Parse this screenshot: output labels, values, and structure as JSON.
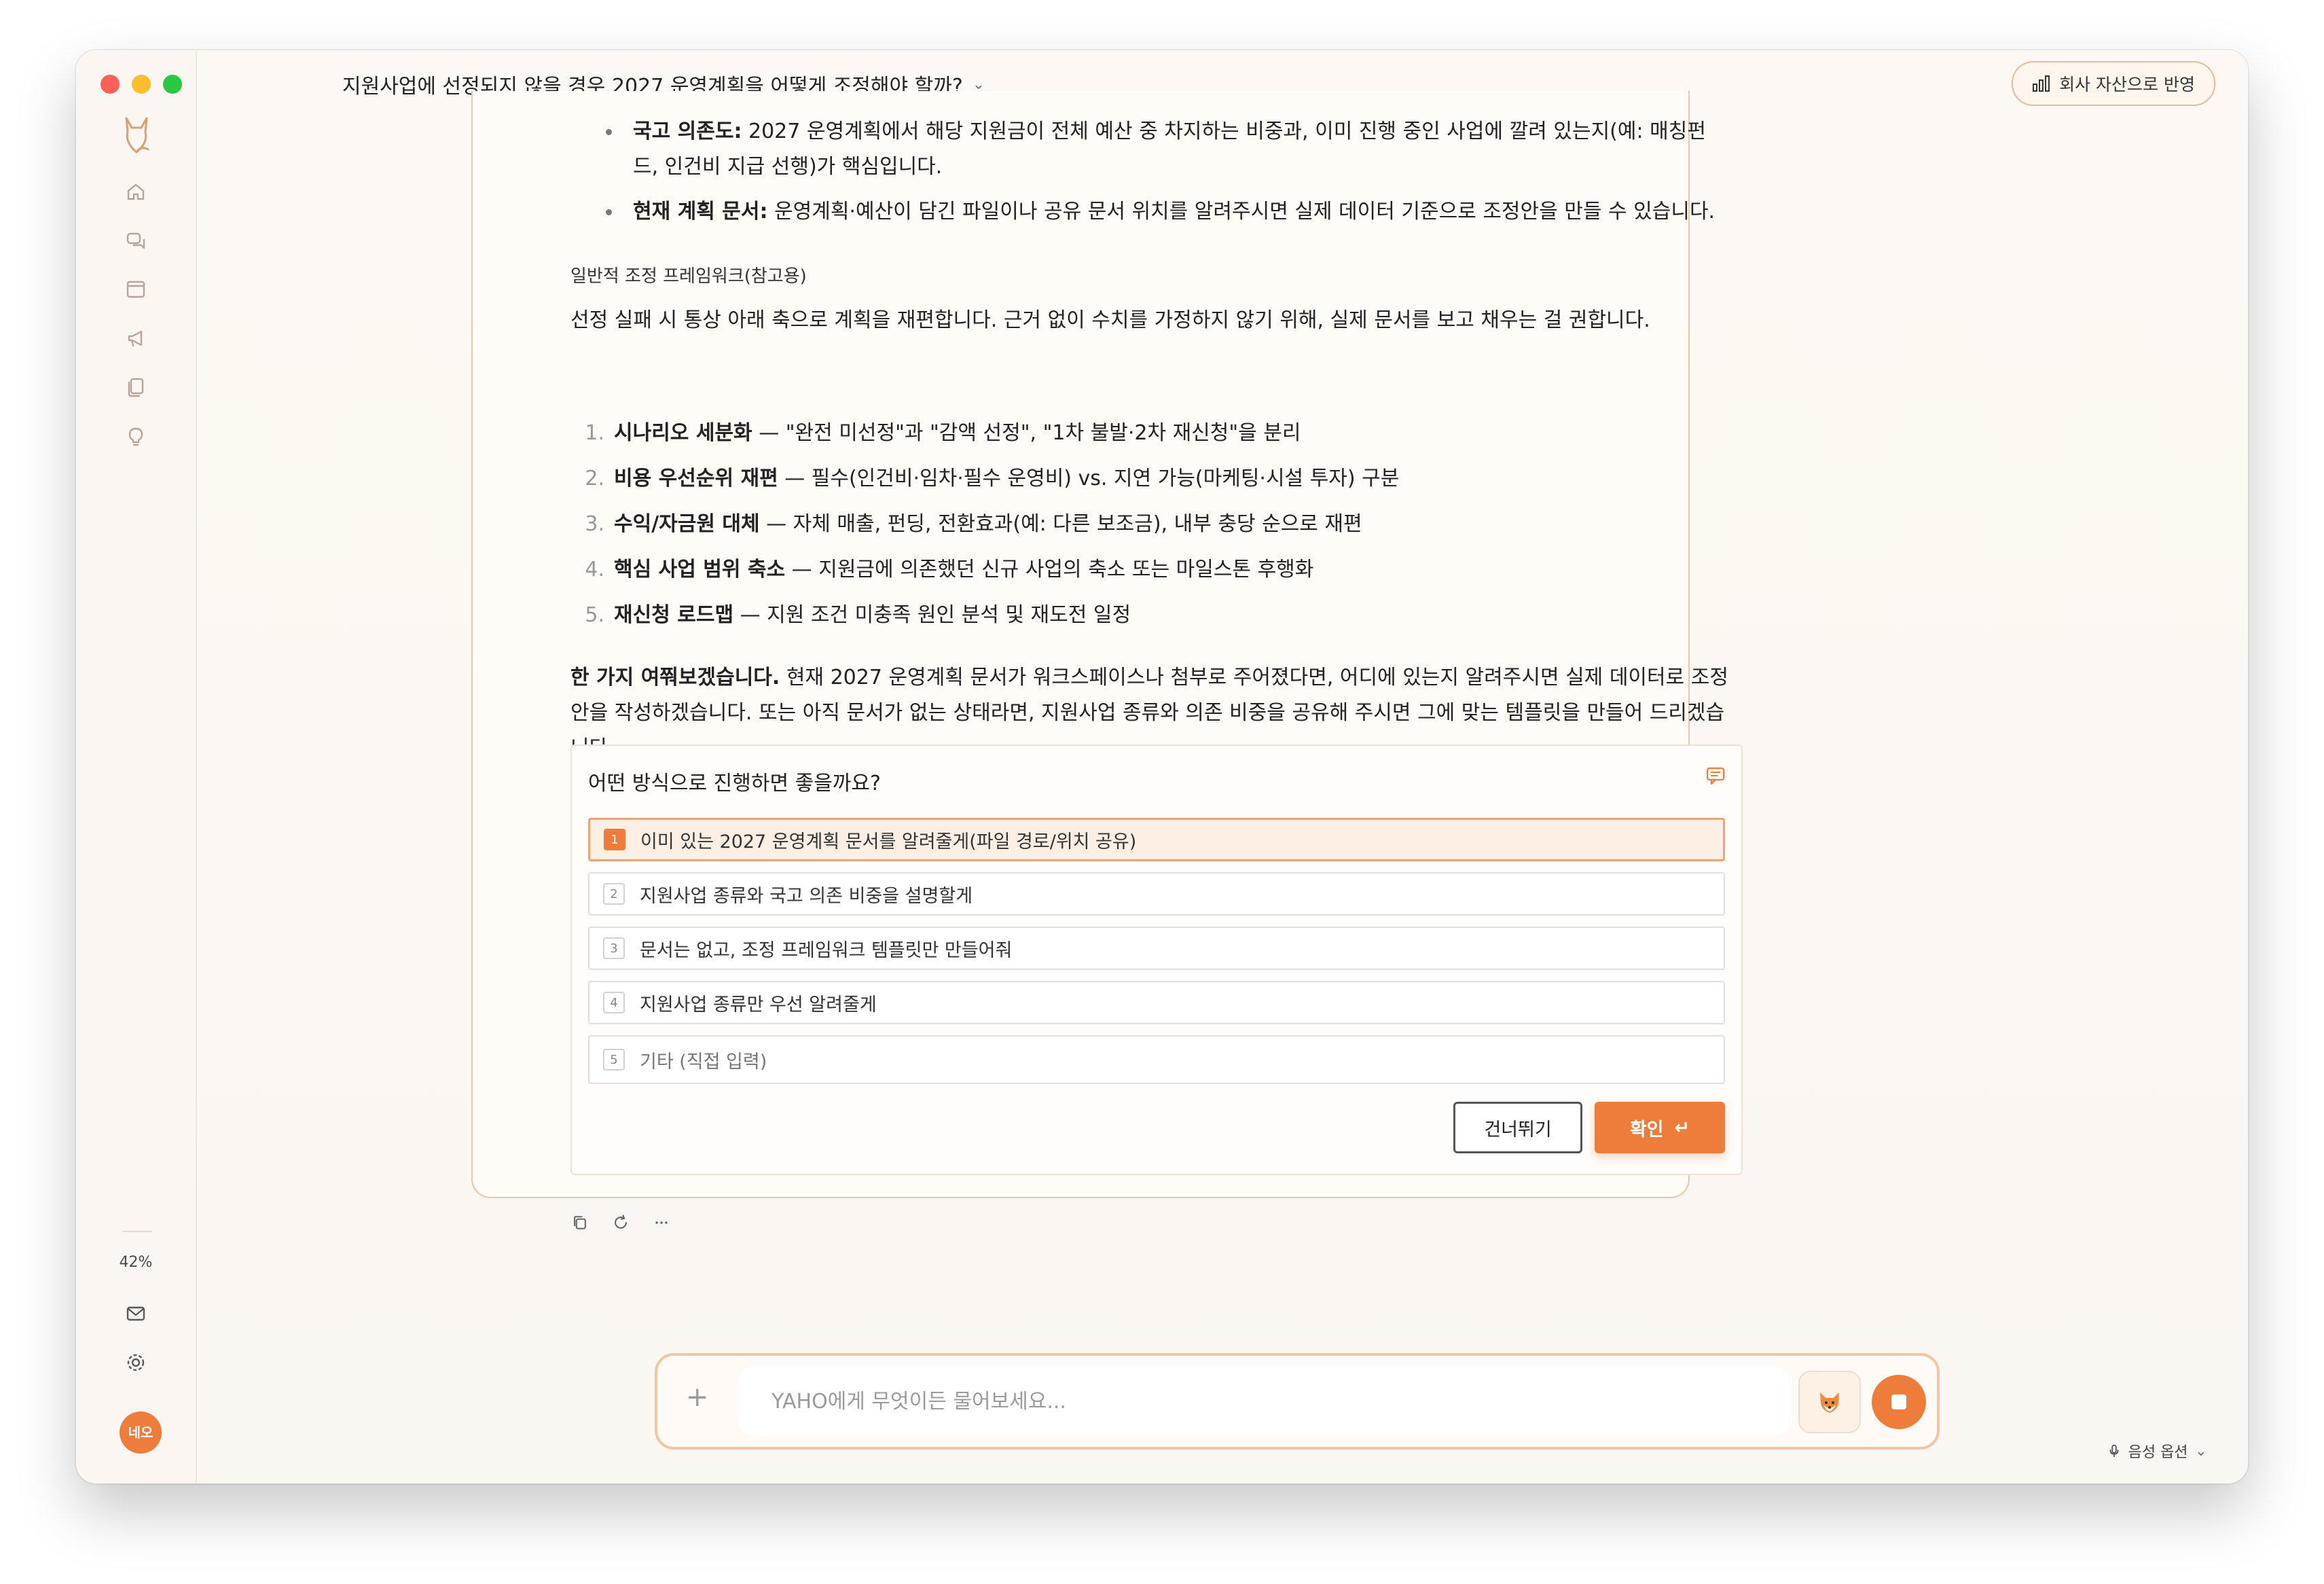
{
  "window": {
    "title": "지원사업에 선정되지 않을 경우 2027 운영계획을 어떻게 조정해야 할까?"
  },
  "header": {
    "reflect_label": "회사 자산으로 반영"
  },
  "sidebar": {
    "icons": [
      "home-icon",
      "chat-icon",
      "browser-icon",
      "megaphone-icon",
      "documents-icon",
      "lightbulb-icon"
    ],
    "zoom": "42%",
    "avatar": "네오"
  },
  "message": {
    "bullets": [
      {
        "bold": "국고 의존도:",
        "text": " 2027 운영계획에서 해당 지원금이 전체 예산 중 차지하는 비중과, 이미 진행 중인 사업에 깔려 있는지(예: 매칭펀드, 인건비 지급 선행)가 핵심입니다."
      },
      {
        "bold": "현재 계획 문서:",
        "text": " 운영계획·예산이 담긴 파일이나 공유 문서 위치를 알려주시면 실제 데이터 기준으로 조정안을 만들 수 있습니다."
      }
    ],
    "section_label": "일반적 조정 프레임워크(참고용)",
    "intro": "선정 실패 시 통상 아래 축으로 계획을 재편합니다. 근거 없이 수치를 가정하지 않기 위해, 실제 문서를 보고 채우는 걸 권합니다.",
    "steps": [
      {
        "num": "1.",
        "bold": "시나리오 세분화",
        "text": " — \"완전 미선정\"과 \"감액 선정\", \"1차 불발·2차 재신청\"을 분리"
      },
      {
        "num": "2.",
        "bold": "비용 우선순위 재편",
        "text": " — 필수(인건비·임차·필수 운영비) vs. 지연 가능(마케팅·시설 투자) 구분"
      },
      {
        "num": "3.",
        "bold": "수익/자금원 대체",
        "text": " — 자체 매출, 펀딩, 전환효과(예: 다른 보조금), 내부 충당 순으로 재편"
      },
      {
        "num": "4.",
        "bold": "핵심 사업 범위 축소",
        "text": " — 지원금에 의존했던 신규 사업의 축소 또는 마일스톤 후행화"
      },
      {
        "num": "5.",
        "bold": "재신청 로드맵",
        "text": " — 지원 조건 미충족 원인 분석 및 재도전 일정"
      }
    ],
    "closing_bold": "한 가지 여쭤보겠습니다.",
    "closing_text": " 현재 2027 운영계획 문서가 워크스페이스나 첨부로 주어졌다면, 어디에 있는지 알려주시면 실제 데이터로 조정안을 작성하겠습니다. 또는 아직 문서가 없는 상태라면, 지원사업 종류와 의존 비중을 공유해 주시면 그에 맞는 템플릿을 만들어 드리겠습니다."
  },
  "question": {
    "title": "어떤 방식으로 진행하면 좋을까요?",
    "options": [
      {
        "num": "1",
        "label": "이미 있는 2027 운영계획 문서를 알려줄게(파일 경로/위치 공유)"
      },
      {
        "num": "2",
        "label": "지원사업 종류와 국고 의존 비중을 설명할게"
      },
      {
        "num": "3",
        "label": "문서는 없고, 조정 프레임워크 템플릿만 만들어줘"
      },
      {
        "num": "4",
        "label": "지원사업 종류만 우선 알려줄게"
      },
      {
        "num": "5",
        "label": "기타 (직접 입력)"
      }
    ],
    "selected": 1,
    "skip_label": "건너뛰기",
    "confirm_label": "확인",
    "confirm_key": "↵"
  },
  "composer": {
    "placeholder": "YAHO에게 무엇이든 물어보세요...",
    "plus": "+"
  },
  "footer": {
    "voice_label": "음성 옵션"
  },
  "colors": {
    "accent": "#ee7d3c",
    "accent_border": "#f0c49f",
    "background": "#fdf8f3"
  }
}
